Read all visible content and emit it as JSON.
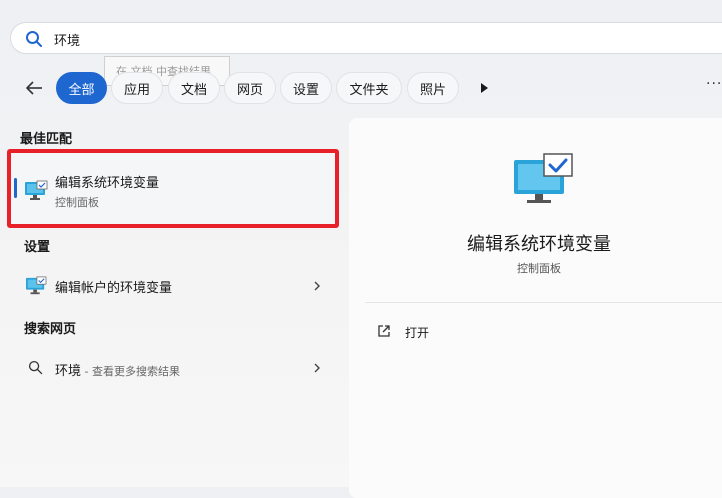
{
  "search": {
    "query": "环境"
  },
  "tooltip": {
    "text": "在 文档 中查找结果"
  },
  "tabs": [
    {
      "label": "全部",
      "active": true
    },
    {
      "label": "应用"
    },
    {
      "label": "文档"
    },
    {
      "label": "网页"
    },
    {
      "label": "设置"
    },
    {
      "label": "文件夹"
    },
    {
      "label": "照片"
    }
  ],
  "best_match": {
    "heading": "最佳匹配",
    "title": "编辑系统环境变量",
    "subtitle": "控制面板"
  },
  "settings": {
    "heading": "设置",
    "item_title": "编辑帐户的环境变量"
  },
  "web": {
    "heading": "搜索网页",
    "item_title": "环境",
    "item_suffix": " - 查看更多搜索结果"
  },
  "preview": {
    "title": "编辑系统环境变量",
    "subtitle": "控制面板",
    "open_label": "打开"
  },
  "colors": {
    "accent": "#1e66d0",
    "highlight_border": "#e8202a"
  }
}
